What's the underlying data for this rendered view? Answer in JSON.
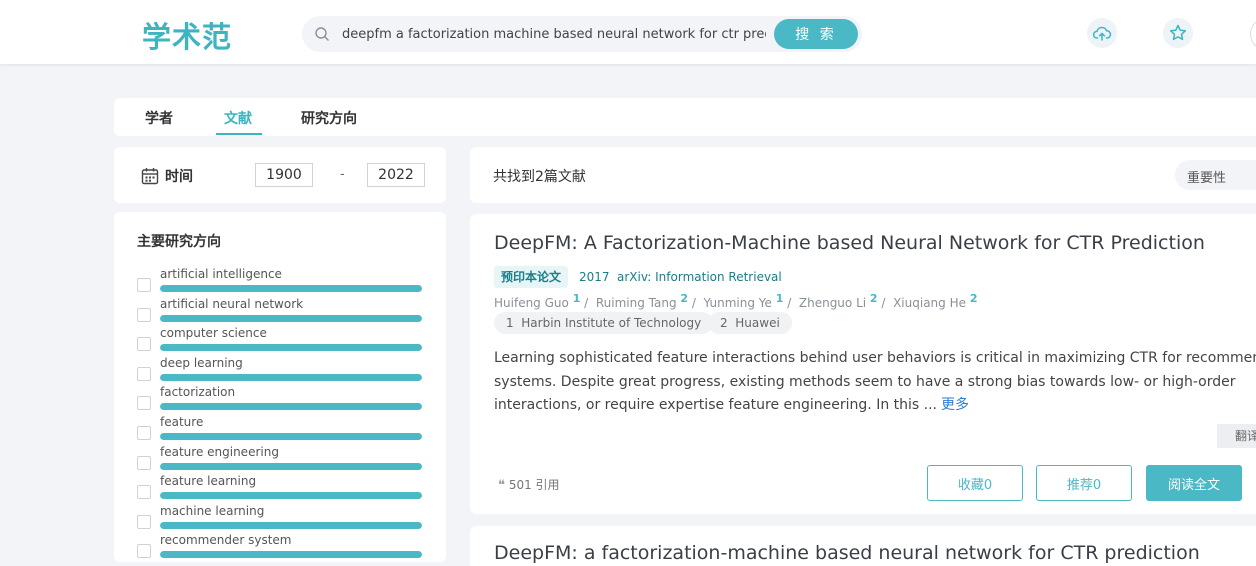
{
  "header": {
    "logo": "学术范",
    "search": {
      "value": "deepfm a factorization machine based neural network for ctr predict",
      "button": "搜 索"
    },
    "icons": [
      "cloud-upload-icon",
      "star-icon"
    ]
  },
  "tabs": [
    {
      "label": "学者",
      "active": false
    },
    {
      "label": "文献",
      "active": true
    },
    {
      "label": "研究方向",
      "active": false
    }
  ],
  "time_filter": {
    "label": "时间",
    "from": "1900",
    "separator": "-",
    "to": "2022"
  },
  "directions": {
    "title": "主要研究方向",
    "items": [
      {
        "label": "artificial intelligence",
        "level": 1.0
      },
      {
        "label": "artificial neural network",
        "level": 1.0
      },
      {
        "label": "computer science",
        "level": 1.0
      },
      {
        "label": "deep learning",
        "level": 1.0
      },
      {
        "label": "factorization",
        "level": 1.0
      },
      {
        "label": "feature",
        "level": 1.0
      },
      {
        "label": "feature engineering",
        "level": 1.0
      },
      {
        "label": "feature learning",
        "level": 1.0
      },
      {
        "label": "machine learning",
        "level": 1.0
      },
      {
        "label": "recommender system",
        "level": 1.0
      }
    ]
  },
  "results": {
    "count_text": "共找到2篇文献",
    "sort_label": "重要性"
  },
  "paper": {
    "title": "DeepFM: A Factorization-Machine based Neural Network for CTR Prediction",
    "tag": "预印本论文",
    "year": "2017",
    "venue": "arXiv: Information Retrieval",
    "authors": [
      {
        "name": "Huifeng Guo",
        "aff": "1"
      },
      {
        "name": "Ruiming Tang",
        "aff": "2"
      },
      {
        "name": "Yunming Ye",
        "aff": "1"
      },
      {
        "name": "Zhenguo Li",
        "aff": "2"
      },
      {
        "name": "Xiuqiang He",
        "aff": "2"
      }
    ],
    "affiliations": [
      {
        "num": "1",
        "name": "Harbin Institute of Technology"
      },
      {
        "num": "2",
        "name": "Huawei"
      }
    ],
    "abstract": "Learning sophisticated feature interactions behind user behaviors is critical in maximizing CTR for recommender systems. Despite great progress, existing methods seem to have a strong bias towards low- or high-order interactions, or require expertise feature engineering. In this ...",
    "more": "更多",
    "translate": "翻译",
    "citations": "501 引用",
    "collect": "收藏0",
    "recommend": "推荐0",
    "read": "阅读全文"
  },
  "paper2": {
    "title": "DeepFM: a factorization-machine based neural network for CTR prediction"
  }
}
